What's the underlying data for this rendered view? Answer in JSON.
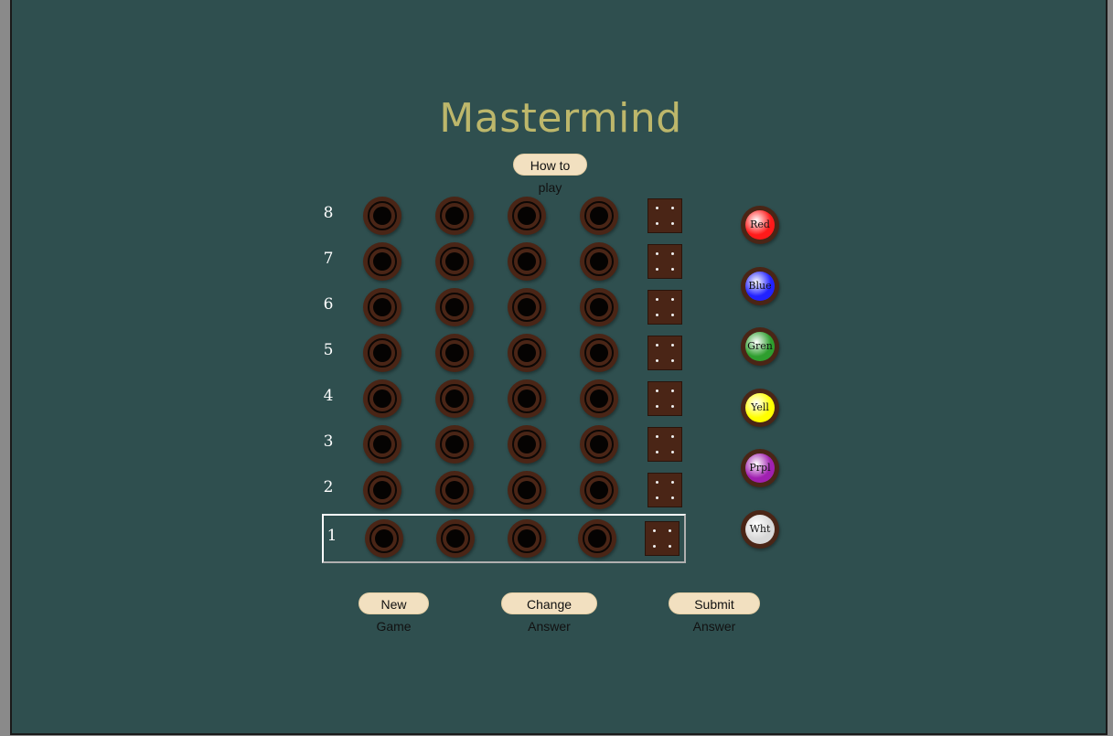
{
  "title": "Mastermind",
  "how_to_play_label": "How to play",
  "rows": [
    "8",
    "7",
    "6",
    "5",
    "4",
    "3",
    "2",
    "1"
  ],
  "active_row": "1",
  "colors": [
    {
      "label": "Red",
      "hex": "#ff1a1a"
    },
    {
      "label": "Blue",
      "hex": "#2222ff"
    },
    {
      "label": "Gren",
      "hex": "#2e9e2e"
    },
    {
      "label": "Yell",
      "hex": "#ffff00"
    },
    {
      "label": "Prpl",
      "hex": "#a020b0"
    },
    {
      "label": "Wht",
      "hex": "#d8d8d8"
    }
  ],
  "buttons": {
    "new_game": "New Game",
    "change_answer": "Change Answer",
    "submit_answer": "Submit Answer"
  },
  "theme": {
    "background": "#2f4f4f",
    "title_color": "#bdb76b",
    "hole_color": "#4a2516",
    "button_color": "#f2e0c0"
  }
}
